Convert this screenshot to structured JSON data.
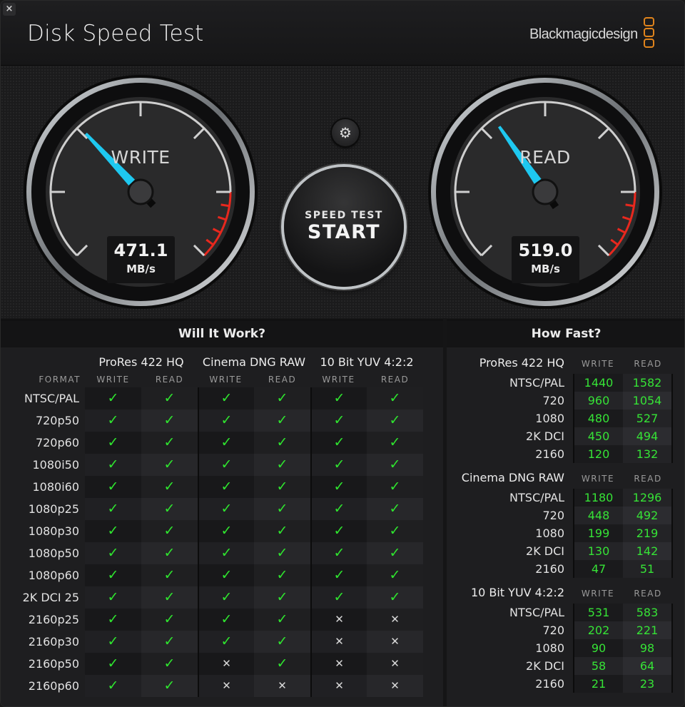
{
  "window": {
    "close_icon": "×",
    "title": "Disk Speed Test"
  },
  "brand": {
    "name": "Blackmagicdesign",
    "logo_color": "#e0841c"
  },
  "gauges": {
    "write": {
      "label": "WRITE",
      "value": "471.1",
      "unit": "MB/s",
      "needle_fraction": 0.34
    },
    "read": {
      "label": "READ",
      "value": "519.0",
      "unit": "MB/s",
      "needle_fraction": 0.37
    }
  },
  "controls": {
    "settings_icon": "⚙",
    "start_sub": "SPEED TEST",
    "start_main": "START"
  },
  "colors": {
    "needle": "#1ec8f0",
    "redline": "#e8281e",
    "ok": "#2fe62f",
    "value_green": "#36e336"
  },
  "will_it_work": {
    "title": "Will It Work?",
    "format_header": "FORMAT",
    "codecs": [
      {
        "name": "ProRes 422 HQ",
        "write": "WRITE",
        "read": "READ"
      },
      {
        "name": "Cinema DNG RAW",
        "write": "WRITE",
        "read": "READ"
      },
      {
        "name": "10 Bit YUV 4:2:2",
        "write": "WRITE",
        "read": "READ"
      }
    ],
    "rows": [
      {
        "format": "NTSC/PAL",
        "results": [
          1,
          1,
          1,
          1,
          1,
          1
        ]
      },
      {
        "format": "720p50",
        "results": [
          1,
          1,
          1,
          1,
          1,
          1
        ]
      },
      {
        "format": "720p60",
        "results": [
          1,
          1,
          1,
          1,
          1,
          1
        ]
      },
      {
        "format": "1080i50",
        "results": [
          1,
          1,
          1,
          1,
          1,
          1
        ]
      },
      {
        "format": "1080i60",
        "results": [
          1,
          1,
          1,
          1,
          1,
          1
        ]
      },
      {
        "format": "1080p25",
        "results": [
          1,
          1,
          1,
          1,
          1,
          1
        ]
      },
      {
        "format": "1080p30",
        "results": [
          1,
          1,
          1,
          1,
          1,
          1
        ]
      },
      {
        "format": "1080p50",
        "results": [
          1,
          1,
          1,
          1,
          1,
          1
        ]
      },
      {
        "format": "1080p60",
        "results": [
          1,
          1,
          1,
          1,
          1,
          1
        ]
      },
      {
        "format": "2K DCI 25",
        "results": [
          1,
          1,
          1,
          1,
          1,
          1
        ]
      },
      {
        "format": "2160p25",
        "results": [
          1,
          1,
          1,
          1,
          0,
          0
        ]
      },
      {
        "format": "2160p30",
        "results": [
          1,
          1,
          1,
          1,
          0,
          0
        ]
      },
      {
        "format": "2160p50",
        "results": [
          1,
          1,
          0,
          1,
          0,
          0
        ]
      },
      {
        "format": "2160p60",
        "results": [
          1,
          1,
          0,
          0,
          0,
          0
        ]
      }
    ],
    "ok_glyph": "✓",
    "fail_glyph": "✕"
  },
  "how_fast": {
    "title": "How Fast?",
    "sections": [
      {
        "codec": "ProRes 422 HQ",
        "write": "WRITE",
        "read": "READ",
        "rows": [
          {
            "label": "NTSC/PAL",
            "write": "1440",
            "read": "1582"
          },
          {
            "label": "720",
            "write": "960",
            "read": "1054"
          },
          {
            "label": "1080",
            "write": "480",
            "read": "527"
          },
          {
            "label": "2K DCI",
            "write": "450",
            "read": "494"
          },
          {
            "label": "2160",
            "write": "120",
            "read": "132"
          }
        ]
      },
      {
        "codec": "Cinema DNG RAW",
        "write": "WRITE",
        "read": "READ",
        "rows": [
          {
            "label": "NTSC/PAL",
            "write": "1180",
            "read": "1296"
          },
          {
            "label": "720",
            "write": "448",
            "read": "492"
          },
          {
            "label": "1080",
            "write": "199",
            "read": "219"
          },
          {
            "label": "2K DCI",
            "write": "130",
            "read": "142"
          },
          {
            "label": "2160",
            "write": "47",
            "read": "51"
          }
        ]
      },
      {
        "codec": "10 Bit YUV 4:2:2",
        "write": "WRITE",
        "read": "READ",
        "rows": [
          {
            "label": "NTSC/PAL",
            "write": "531",
            "read": "583"
          },
          {
            "label": "720",
            "write": "202",
            "read": "221"
          },
          {
            "label": "1080",
            "write": "90",
            "read": "98"
          },
          {
            "label": "2K DCI",
            "write": "58",
            "read": "64"
          },
          {
            "label": "2160",
            "write": "21",
            "read": "23"
          }
        ]
      }
    ]
  }
}
